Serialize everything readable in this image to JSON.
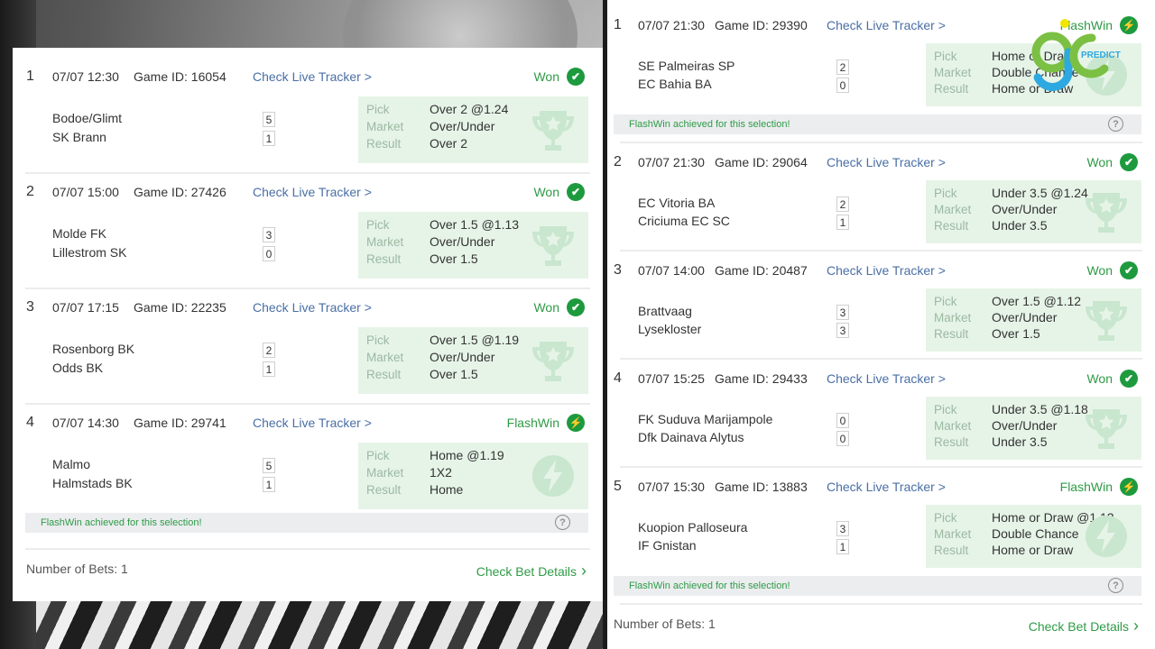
{
  "left": {
    "bets": [
      {
        "n": "1",
        "date": "07/07 12:30",
        "game_id": "Game ID: 16054",
        "tracker": "Check Live Tracker >",
        "status": "Won",
        "status_type": "won",
        "home": "Bodoe/Glimt",
        "away": "SK Brann",
        "home_score": "5",
        "away_score": "1",
        "pick": "Over 2 @1.24",
        "market": "Over/Under",
        "result": "Over 2",
        "emblem": "trophy-icon"
      },
      {
        "n": "2",
        "date": "07/07 15:00",
        "game_id": "Game ID: 27426",
        "tracker": "Check Live Tracker >",
        "status": "Won",
        "status_type": "won",
        "home": "Molde FK",
        "away": "Lillestrom SK",
        "home_score": "3",
        "away_score": "0",
        "pick": "Over 1.5 @1.13",
        "market": "Over/Under",
        "result": "Over 1.5",
        "emblem": "trophy-icon"
      },
      {
        "n": "3",
        "date": "07/07 17:15",
        "game_id": "Game ID: 22235",
        "tracker": "Check Live Tracker >",
        "status": "Won",
        "status_type": "won",
        "home": "Rosenborg BK",
        "away": "Odds BK",
        "home_score": "2",
        "away_score": "1",
        "pick": "Over 1.5 @1.19",
        "market": "Over/Under",
        "result": "Over 1.5",
        "emblem": "trophy-icon"
      },
      {
        "n": "4",
        "date": "07/07 14:30",
        "game_id": "Game ID: 29741",
        "tracker": "Check Live Tracker >",
        "status": "FlashWin",
        "status_type": "flash",
        "home": "Malmo",
        "away": "Halmstads BK",
        "home_score": "5",
        "away_score": "1",
        "pick": "Home @1.19",
        "market": "1X2",
        "result": "Home",
        "emblem": "lightning-icon",
        "flash_note": "FlashWin achieved for this selection!"
      }
    ],
    "footer": {
      "count": "Number of Bets: 1",
      "link": "Check Bet Details"
    }
  },
  "right": {
    "bets": [
      {
        "n": "1",
        "date": "07/07 21:30",
        "game_id": "Game ID: 29390",
        "tracker": "Check Live Tracker >",
        "status": "FlashWin",
        "status_type": "flash",
        "home": "SE Palmeiras SP",
        "away": "EC Bahia BA",
        "home_score": "2",
        "away_score": "0",
        "pick": "Home or Draw",
        "market": "Double Chance",
        "result": "Home or Draw",
        "emblem": "lightning-icon",
        "flash_note": "FlashWin achieved for this selection!"
      },
      {
        "n": "2",
        "date": "07/07 21:30",
        "game_id": "Game ID: 29064",
        "tracker": "Check Live Tracker >",
        "status": "Won",
        "status_type": "won",
        "home": "EC Vitoria BA",
        "away": "Criciuma EC SC",
        "home_score": "2",
        "away_score": "1",
        "pick": "Under 3.5 @1.24",
        "market": "Over/Under",
        "result": "Under 3.5",
        "emblem": "trophy-icon"
      },
      {
        "n": "3",
        "date": "07/07 14:00",
        "game_id": "Game ID: 20487",
        "tracker": "Check Live Tracker >",
        "status": "Won",
        "status_type": "won",
        "home": "Brattvaag",
        "away": "Lysekloster",
        "home_score": "3",
        "away_score": "3",
        "pick": "Over 1.5 @1.12",
        "market": "Over/Under",
        "result": "Over 1.5",
        "emblem": "trophy-icon"
      },
      {
        "n": "4",
        "date": "07/07 15:25",
        "game_id": "Game ID: 29433",
        "tracker": "Check Live Tracker >",
        "status": "Won",
        "status_type": "won",
        "home": "FK Suduva Marijampole",
        "away": "Dfk Dainava Alytus",
        "home_score": "0",
        "away_score": "0",
        "pick": "Under 3.5 @1.18",
        "market": "Over/Under",
        "result": "Under 3.5",
        "emblem": "trophy-icon"
      },
      {
        "n": "5",
        "date": "07/07 15:30",
        "game_id": "Game ID: 13883",
        "tracker": "Check Live Tracker >",
        "status": "FlashWin",
        "status_type": "flash",
        "home": "Kuopion Palloseura",
        "away": "IF Gnistan",
        "home_score": "3",
        "away_score": "1",
        "pick": "Home or Draw @1.12",
        "market": "Double Chance",
        "result": "Home or Draw",
        "emblem": "lightning-icon",
        "flash_note": "FlashWin achieved for this selection!"
      }
    ],
    "footer": {
      "count": "Number of Bets: 1",
      "link": "Check Bet Details"
    }
  },
  "labels": {
    "pick": "Pick",
    "market": "Market",
    "result": "Result",
    "help": "?"
  },
  "logo": {
    "text": "PREDICTOR",
    "colors": [
      "#f2e600",
      "#7bc043",
      "#2ea8e0"
    ]
  },
  "colors": {
    "won_green": "#1e9a3e",
    "link_blue": "#4a6fa5",
    "pick_bg": "#e6f4e8"
  }
}
